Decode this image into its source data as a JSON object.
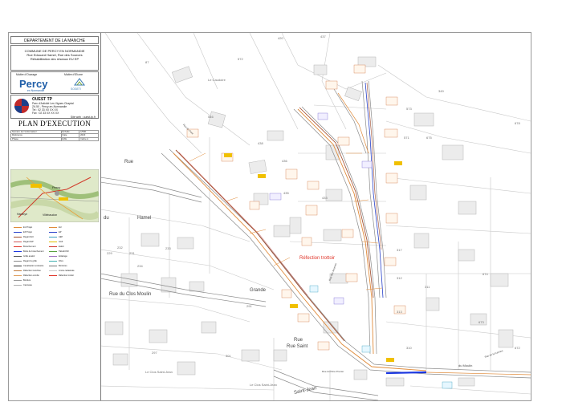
{
  "title_block": {
    "department": "DEPARTEMENT DE LA MANCHE",
    "commune": "COMMUNE DE PERCY EN NORMANDIE",
    "streets": "Rue Edouard Hamel, Rue des Sources",
    "project": "Réhabilitation des réseaux EU EP",
    "owner_caption": "Maître d'Ouvrage",
    "engineer_caption": "Maître d'Œuvre",
    "owner_logo": "Percy",
    "owner_logo_sub": "en Normandie",
    "engineer_logo": "SOGETI",
    "company": "OUEST TP",
    "company_addr1": "Parc d'Activité Les Vignes Chaptal",
    "company_addr2": "ZA 50 - Percy-en-Normandie",
    "company_tel": "Tel : 02 33 XX XX XX",
    "company_fax": "Fax : 02 33 XX XX XX",
    "company_web": "Site web : ouest-tp.fr",
    "plan_title": "PLAN D'EXECUTION"
  },
  "info_table": {
    "rows": [
      [
        "Numéro de l'ordonnateur",
        "Échelle",
        "1/500"
      ],
      [
        "Référence",
        "Date",
        "2023"
      ],
      [
        "Phase",
        "EXE",
        "Indice A"
      ]
    ]
  },
  "legend": {
    "col1": [
      "EU Projet",
      "EP Projet",
      "Regard EU",
      "Regard EP",
      "Branchement",
      "Boîte de branchement",
      "Grille avaloir",
      "Regard à grille",
      "Canalisation existante",
      "Réfection tranchée",
      "Réfection enrobé",
      "Bordure",
      "Caniveau"
    ],
    "col2": [
      "EU",
      "EP",
      "AEP",
      "GAZ",
      "ELEC",
      "TELECOM",
      "Eclairage",
      "Fibre",
      "Bordures",
      "Limite cadastrale",
      "Réfection trottoir"
    ]
  },
  "map": {
    "parcels": [
      "420",
      "437",
      "87",
      "572",
      "546",
      "438",
      "436",
      "435",
      "433",
      "317",
      "312",
      "313",
      "310",
      "311",
      "349",
      "674",
      "673",
      "229",
      "230",
      "231",
      "232",
      "233",
      "234",
      "291",
      "297",
      "301",
      "249",
      "181",
      "672",
      "571",
      "573",
      "675",
      "678"
    ],
    "streets": [
      "Rue",
      "du",
      "Hamel",
      "Rue du Clos Moulin",
      "Grande",
      "Rue",
      "Saint-Jean",
      "Rue Saint",
      "du Moulin",
      "Rue du Père Prunier",
      "Rue de la Cannes",
      "Rue des Sources",
      "Rue du Pont"
    ],
    "localities": [
      "Le Caudoire",
      "Le Clos Saint-Jean",
      "Le Clos Saint-Jean"
    ],
    "annotation": "Réfection trottoir",
    "minimap_labels": [
      "Percy",
      "Hambye",
      "Villebaudon"
    ]
  },
  "colors": {
    "annotation": "#e0362b",
    "network_orange": "#e08b3a",
    "network_brown": "#a04a2a",
    "network_blue": "#2740c9",
    "parcel_line": "#bdbdbd",
    "building_fill": "#ebebeb"
  }
}
